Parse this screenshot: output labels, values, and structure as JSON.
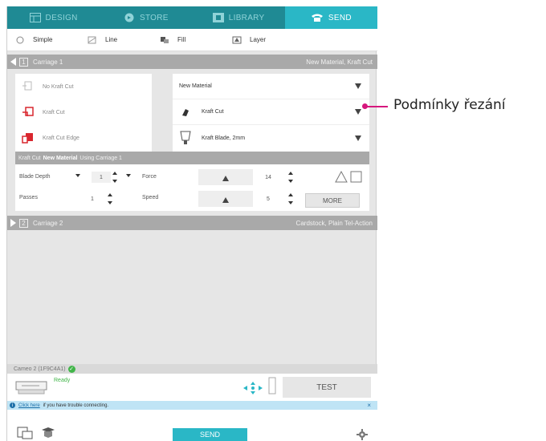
{
  "tabs": [
    {
      "label": "DESIGN",
      "icon": "design-icon"
    },
    {
      "label": "STORE",
      "icon": "store-icon"
    },
    {
      "label": "LIBRARY",
      "icon": "library-icon"
    },
    {
      "label": "SEND",
      "icon": "send-icon"
    }
  ],
  "active_tab": "SEND",
  "modes": [
    {
      "label": "Simple",
      "icon": "radio-icon"
    },
    {
      "label": "Line",
      "icon": "line-mode-icon"
    },
    {
      "label": "Fill",
      "icon": "fill-mode-icon"
    },
    {
      "label": "Layer",
      "icon": "layer-mode-icon"
    }
  ],
  "carriage1": {
    "number": "1",
    "label": "Carriage 1",
    "material": "New Material, Kraft Cut"
  },
  "cut_options": [
    {
      "label": "No Kraft Cut",
      "icon": "no-cut-icon"
    },
    {
      "label": "Kraft Cut",
      "icon": "kraft-cut-icon"
    },
    {
      "label": "Kraft Cut Edge",
      "icon": "kraft-cut-edge-icon"
    }
  ],
  "material_select": "New Material",
  "action_select": "Kraft Cut",
  "tool_select": "Kraft Blade, 2mm",
  "settings": {
    "prefix": "Kraft Cut",
    "material": "New Material",
    "suffix": "Using Carriage 1",
    "blade_depth_label": "Blade Depth",
    "blade_depth_value": "1",
    "passes_label": "Passes",
    "passes_value": "1",
    "force_label": "Force",
    "force_value": "14",
    "speed_label": "Speed",
    "speed_value": "5",
    "more_label": "MORE"
  },
  "carriage2": {
    "number": "2",
    "label": "Carriage 2",
    "material": "Cardstock, Plain Tel-Action"
  },
  "status_text": "Cameo 2 (1F9C4A1)",
  "ready_text": "Ready",
  "test_label": "TEST",
  "notice": {
    "link": "Click here",
    "text": "if you have trouble connecting."
  },
  "send_label": "SEND",
  "callout_label": "Podmínky řezání",
  "colors": {
    "teal": "#2ab7c6",
    "dark_teal": "#1f8a94",
    "callout": "#d6177d",
    "cut_red": "#d9262e",
    "ready_green": "#41b549"
  }
}
